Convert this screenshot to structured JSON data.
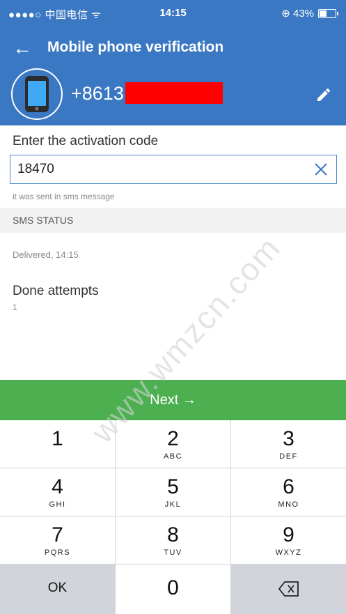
{
  "status_bar": {
    "carrier": "●●●●○ 中国电信 ᯤ",
    "time": "14:15",
    "battery": "⊕ 43%"
  },
  "header": {
    "back_label": "←",
    "title": "Mobile phone verification",
    "phone_prefix": "+8613"
  },
  "code": {
    "label": "Enter the activation code",
    "value": "18470",
    "hint": "it was sent in sms message"
  },
  "sms_status": {
    "header": "SMS STATUS",
    "value": "Delivered, 14:15"
  },
  "attempts": {
    "label": "Done attempts",
    "value": "1"
  },
  "next_button": {
    "label": "Next →"
  },
  "keypad": {
    "keys": [
      {
        "digit": "1",
        "letters": ""
      },
      {
        "digit": "2",
        "letters": "ABC"
      },
      {
        "digit": "3",
        "letters": "DEF"
      },
      {
        "digit": "4",
        "letters": "GHI"
      },
      {
        "digit": "5",
        "letters": "JKL"
      },
      {
        "digit": "6",
        "letters": "MNO"
      },
      {
        "digit": "7",
        "letters": "PQRS"
      },
      {
        "digit": "8",
        "letters": "TUV"
      },
      {
        "digit": "9",
        "letters": "WXYZ"
      }
    ],
    "ok_label": "OK",
    "zero": "0"
  },
  "watermark": "www.wmzcn.com",
  "colors": {
    "primary": "#3a78c3",
    "next_green": "#4caf50",
    "redaction": "#ff0000"
  },
  "icons": {
    "back": "arrow-left-icon",
    "edit": "pencil-icon",
    "clear": "close-icon",
    "backspace": "backspace-icon"
  }
}
